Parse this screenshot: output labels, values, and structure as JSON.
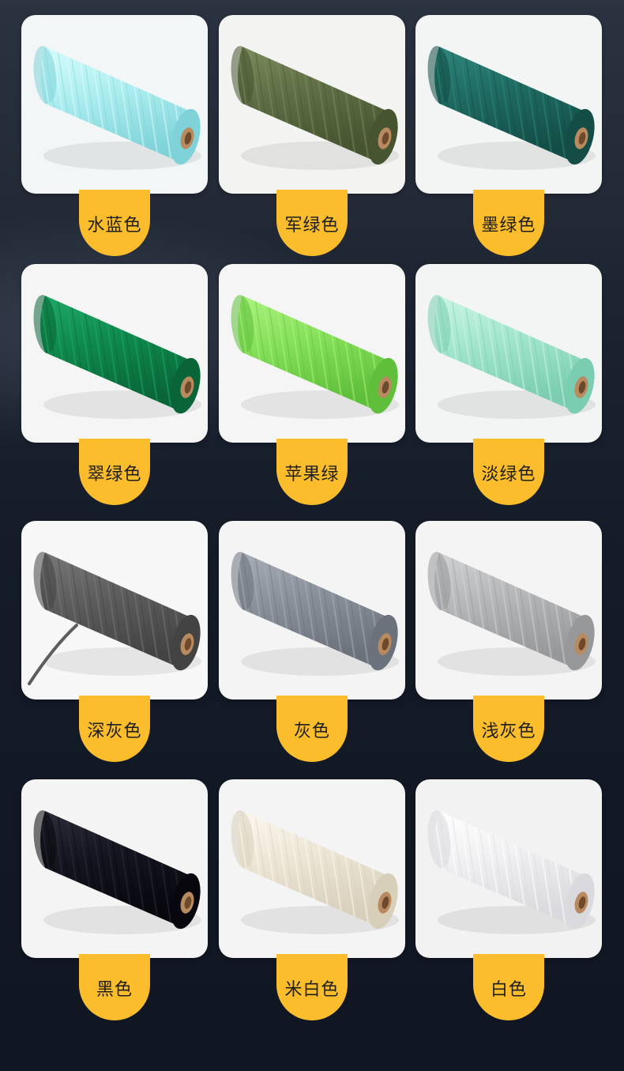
{
  "swatches": [
    {
      "label": "水蓝色",
      "color": "#aeeef0",
      "shade": "#7fd3d8",
      "light": "#d8fbfb",
      "bg": "#f3f6f7"
    },
    {
      "label": "军绿色",
      "color": "#5f6e46",
      "shade": "#46542f",
      "light": "#7b8b5c",
      "bg": "#f3f3f2"
    },
    {
      "label": "墨绿色",
      "color": "#1f6b62",
      "shade": "#134d46",
      "light": "#2f867b",
      "bg": "#f3f4f4"
    },
    {
      "label": "翠绿色",
      "color": "#0f8a4e",
      "shade": "#096537",
      "light": "#1fa867",
      "bg": "#f4f5f4"
    },
    {
      "label": "苹果绿",
      "color": "#86e05a",
      "shade": "#5fbf3a",
      "light": "#aaf27f",
      "bg": "#f4f5f4"
    },
    {
      "label": "淡绿色",
      "color": "#a3e6cc",
      "shade": "#7acdb0",
      "light": "#c9f5e3",
      "bg": "#f3f5f5"
    },
    {
      "label": "深灰色",
      "color": "#5d5d5d",
      "shade": "#434343",
      "light": "#777777",
      "bg": "#f7f7f7"
    },
    {
      "label": "灰色",
      "color": "#8b919b",
      "shade": "#6c727c",
      "light": "#a7adb7",
      "bg": "#f4f4f5"
    },
    {
      "label": "浅灰色",
      "color": "#b5b7b9",
      "shade": "#96989a",
      "light": "#d0d2d4",
      "bg": "#f4f4f4"
    },
    {
      "label": "黑色",
      "color": "#141520",
      "shade": "#07070d",
      "light": "#2b2c38",
      "bg": "#f4f4f4"
    },
    {
      "label": "米白色",
      "color": "#ede6d6",
      "shade": "#d8cfbb",
      "light": "#fbf7ee",
      "bg": "#f4f4f4"
    },
    {
      "label": "白色",
      "color": "#f0f0f2",
      "shade": "#d9d9de",
      "light": "#ffffff",
      "bg": "#f2f2f3"
    }
  ]
}
